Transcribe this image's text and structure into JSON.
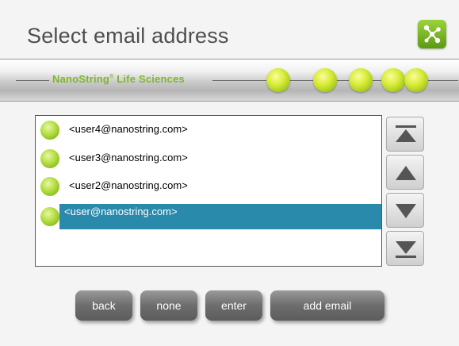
{
  "header": {
    "title": "Select email address"
  },
  "brand": {
    "name": "NanoString",
    "trademark": "®",
    "suffix": " Life Sciences",
    "accent_color": "#7cb82a"
  },
  "email_list": {
    "items": [
      {
        "label": "<user4@nanostring.com>",
        "selected": false
      },
      {
        "label": "<user3@nanostring.com>",
        "selected": false
      },
      {
        "label": "<user2@nanostring.com>",
        "selected": false
      },
      {
        "label": "<user@nanostring.com>",
        "selected": true
      }
    ],
    "selection_color": "#2a8aab"
  },
  "scroll_buttons": {
    "icons": [
      "scroll-top-icon",
      "scroll-up-icon",
      "scroll-down-icon",
      "scroll-bottom-icon"
    ]
  },
  "buttons": {
    "back": "back",
    "none": "none",
    "enter": "enter",
    "add_email": "add email"
  }
}
